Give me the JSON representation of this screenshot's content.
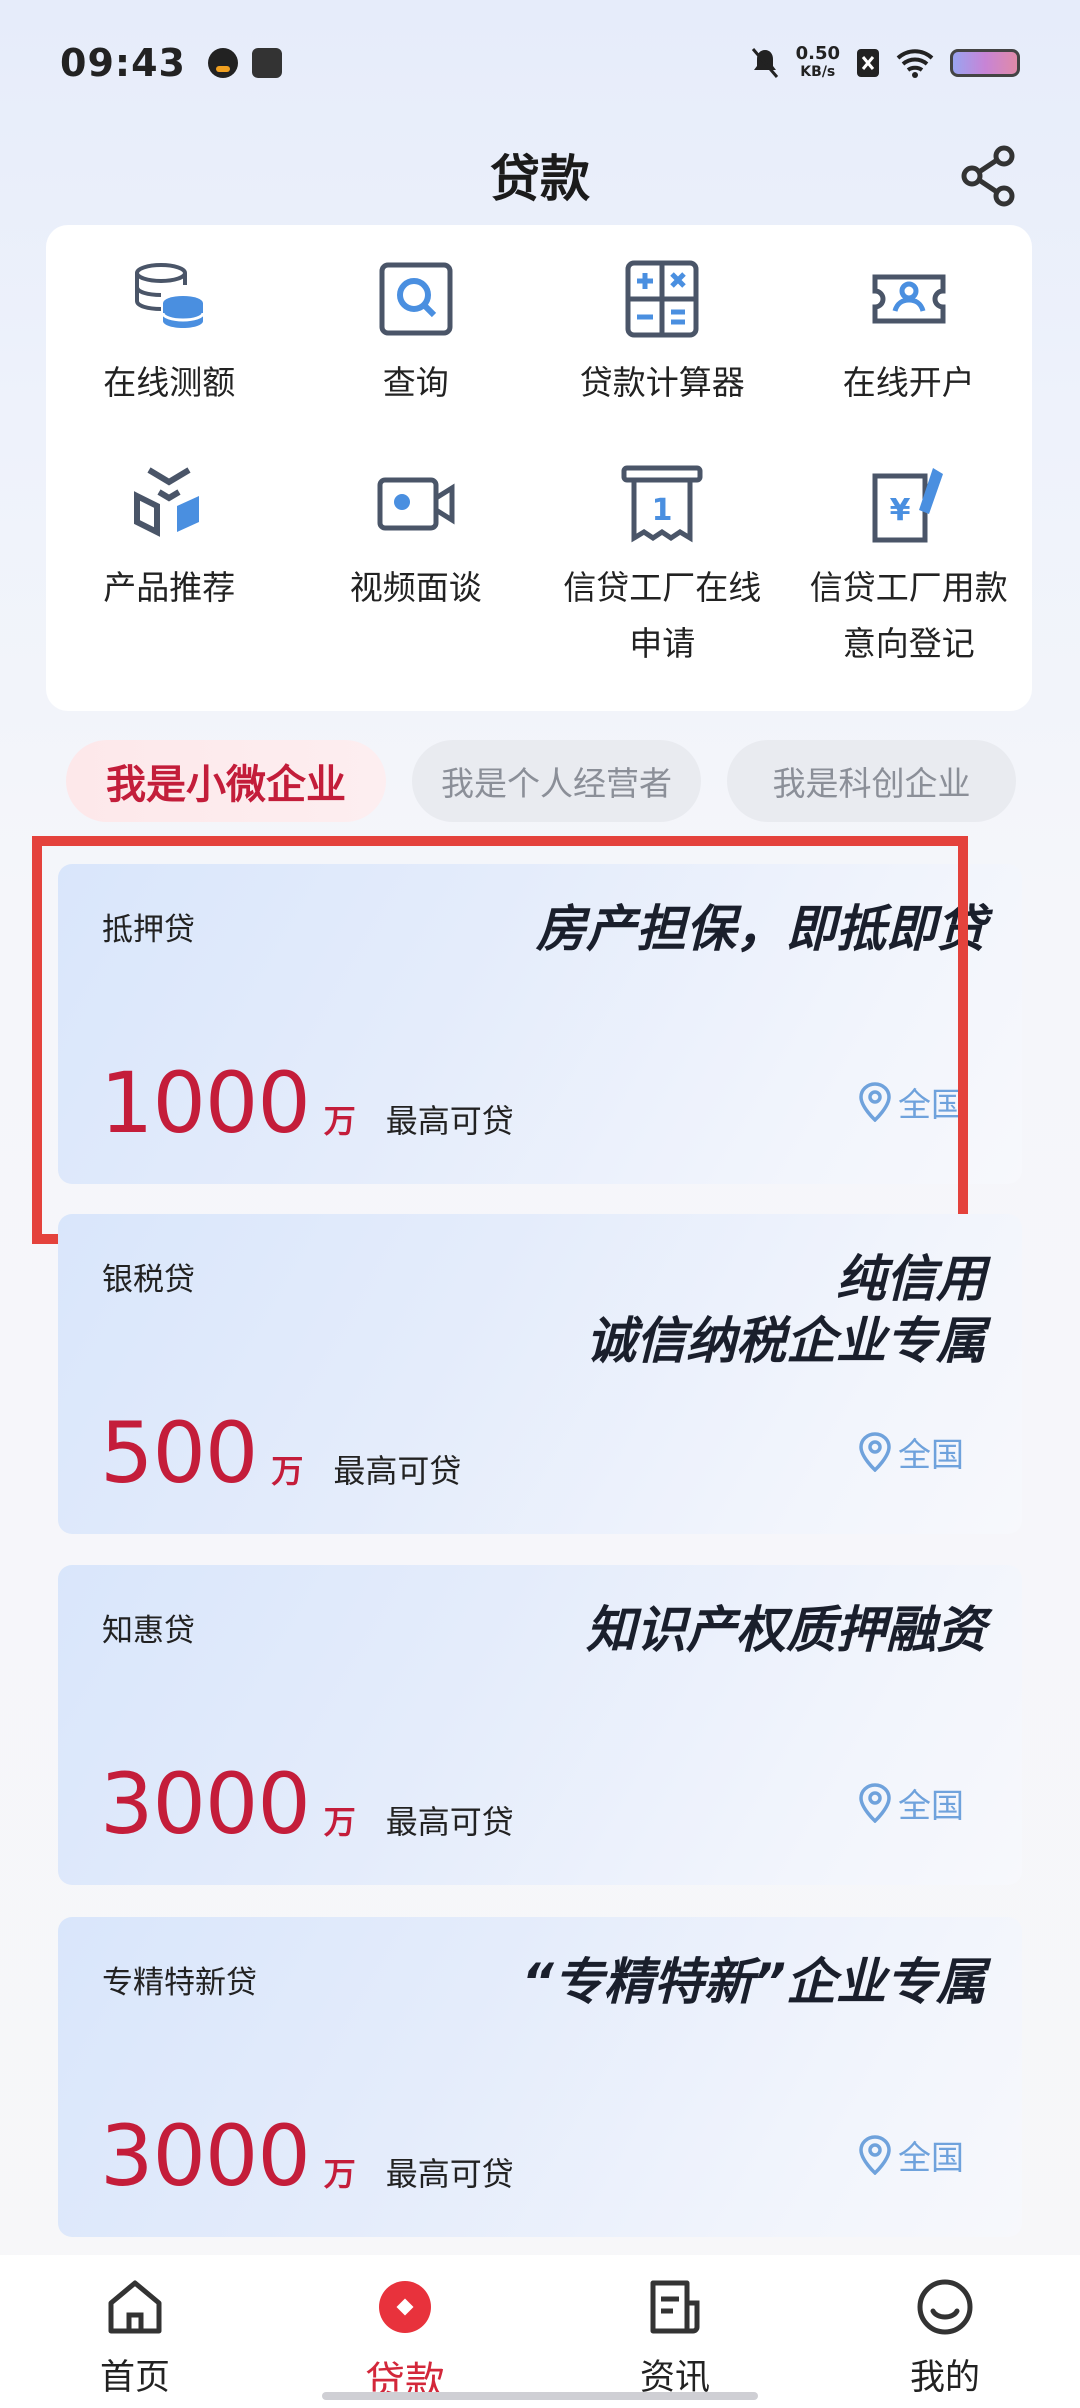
{
  "status_bar": {
    "time": "09:43",
    "net_speed_value": "0.50",
    "net_speed_unit": "KB/s"
  },
  "header": {
    "title": "贷款"
  },
  "grid": [
    {
      "label": "在线测额",
      "icon": "database-icon"
    },
    {
      "label": "查询",
      "icon": "search-icon"
    },
    {
      "label": "贷款计算器",
      "icon": "calculator-icon"
    },
    {
      "label": "在线开户",
      "icon": "account-card-icon"
    },
    {
      "label": "产品推荐",
      "icon": "product-recommend-icon"
    },
    {
      "label": "视频面谈",
      "icon": "video-icon"
    },
    {
      "label": "信贷工厂在线申请",
      "icon": "credit-apply-icon"
    },
    {
      "label": "信贷工厂用款意向登记",
      "icon": "loan-register-icon"
    }
  ],
  "tabs": [
    "我是小微企业",
    "我是个人经营者",
    "我是科创企业"
  ],
  "loans": [
    {
      "name": "抵押贷",
      "slogan_line1": "房产担保，即抵即贷",
      "slogan_line2": "",
      "amount": "1000",
      "unit": "万",
      "amount_label": "最高可贷",
      "region": "全国"
    },
    {
      "name": "银税贷",
      "slogan_line1": "纯信用",
      "slogan_line2": "诚信纳税企业专属",
      "amount": "500",
      "unit": "万",
      "amount_label": "最高可贷",
      "region": "全国"
    },
    {
      "name": "知惠贷",
      "slogan_line1": "知识产权质押融资",
      "slogan_line2": "",
      "amount": "3000",
      "unit": "万",
      "amount_label": "最高可贷",
      "region": "全国"
    },
    {
      "name": "专精特新贷",
      "slogan_line1": "“专精特新”企业专属",
      "slogan_line2": "",
      "amount": "3000",
      "unit": "万",
      "amount_label": "最高可贷",
      "region": "全国"
    }
  ],
  "bottom_nav": [
    {
      "label": "首页",
      "icon": "home-icon"
    },
    {
      "label": "贷款",
      "icon": "loan-icon",
      "active": true
    },
    {
      "label": "资讯",
      "icon": "news-icon"
    },
    {
      "label": "我的",
      "icon": "profile-icon"
    }
  ],
  "colors": {
    "accent_red": "#c41d3a",
    "icon_blue": "#4a8fe0",
    "icon_dark": "#4a5568",
    "highlight": "#e4423c"
  }
}
